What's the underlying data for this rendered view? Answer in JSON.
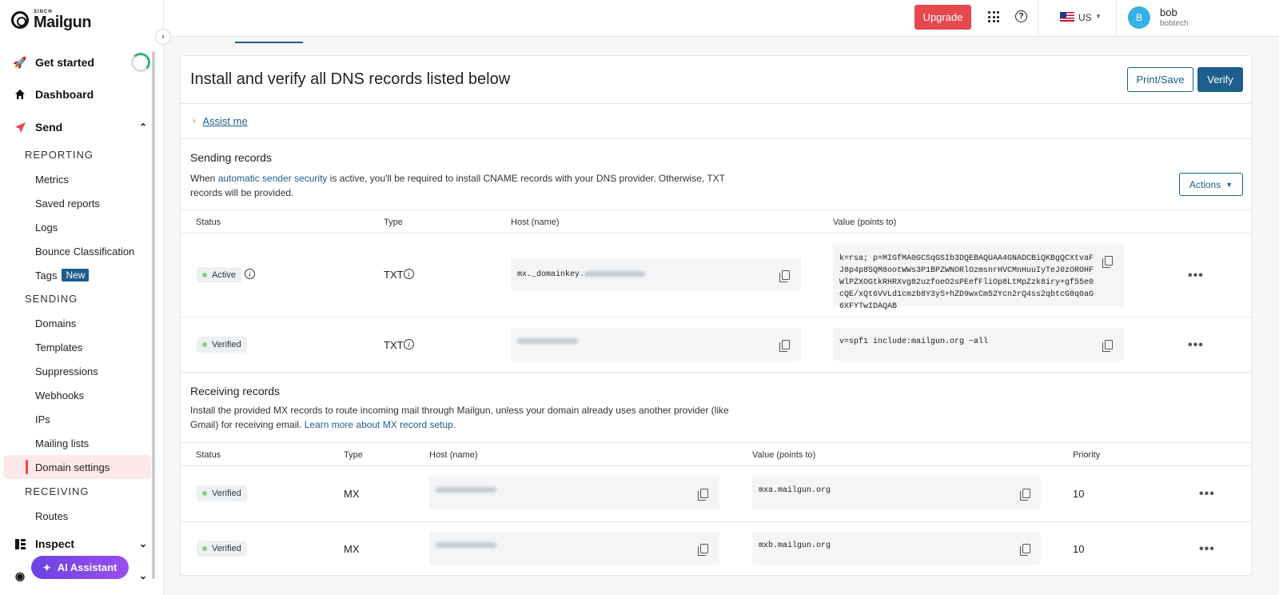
{
  "app": {
    "brand_sub": "SINCH",
    "brand": "Mailgun"
  },
  "topbar": {
    "upgrade_label": "Upgrade",
    "lang": "US",
    "avatar_initial": "B",
    "user_name": "bob",
    "user_org": "bobtech"
  },
  "sidebar": {
    "get_started": "Get started",
    "dashboard": "Dashboard",
    "send": "Send",
    "reporting_title": "REPORTING",
    "reporting_items": [
      "Metrics",
      "Saved reports",
      "Logs",
      "Bounce Classification",
      "Tags"
    ],
    "tags_badge": "New",
    "sending_title": "SENDING",
    "sending_items": [
      "Domains",
      "Templates",
      "Suppressions",
      "Webhooks",
      "IPs",
      "Mailing lists",
      "Domain settings"
    ],
    "receiving_title": "RECEIVING",
    "receiving_items": [
      "Routes"
    ],
    "inspect": "Inspect",
    "ai_assistant": "AI Assistant"
  },
  "main": {
    "title": "Install and verify all DNS records listed below",
    "print_label": "Print/Save",
    "verify_label": "Verify",
    "assist_label": "Assist me",
    "sending": {
      "heading": "Sending records",
      "desc_pre": "When ",
      "desc_link": "automatic sender security",
      "desc_post": " is active, you'll be required to install CNAME records with your DNS provider. Otherwise, TXT records will be provided.",
      "actions_label": "Actions",
      "columns": [
        "Status",
        "Type",
        "Host (name)",
        "Value (points to)"
      ],
      "rows": [
        {
          "status": "Active",
          "type": "TXT",
          "host": "mx._domainkey.",
          "value": "k=rsa; p=MIGfMA0GCSqGSIb3DQEBAQUAA4GNADCBiQKBgQCXtvaFJ8p4p8SQM8ootWWs3P1BPZWNORlOzmsnrHVCMnHuuIyTeJ0zOROHFWlPZXOGtkRHRXvg82uzfoeO2sPEefFliOp8LtMpZzk8iry+gf55e0cQE/xQt6VVLd1cmzb8Y3yS+hZD9wxCm52Ycn2rQ4ss2qbtcG8q0aG6XFYTwIDAQAB"
        },
        {
          "status": "Verified",
          "type": "TXT",
          "host": "",
          "value": "v=spf1 include:mailgun.org ~all"
        }
      ]
    },
    "receiving": {
      "heading": "Receiving records",
      "desc_pre": "Install the provided MX records to route incoming mail through Mailgun, unless your domain already uses another provider (like Gmail) for receiving email. ",
      "desc_link": "Learn more about MX record setup.",
      "columns": [
        "Status",
        "Type",
        "Host (name)",
        "Value (points to)",
        "Priority"
      ],
      "rows": [
        {
          "status": "Verified",
          "type": "MX",
          "value": "mxa.mailgun.org",
          "priority": "10"
        },
        {
          "status": "Verified",
          "type": "MX",
          "value": "mxb.mailgun.org",
          "priority": "10"
        }
      ]
    }
  }
}
